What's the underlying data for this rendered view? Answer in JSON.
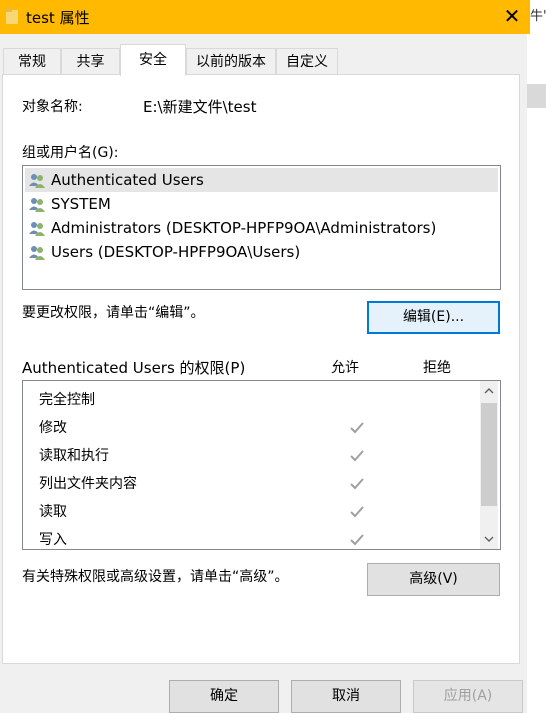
{
  "window": {
    "title": "test 属性",
    "close_glyph": "✕",
    "right_edge_text": "牛'"
  },
  "tabs": [
    {
      "label": "常规",
      "active": false
    },
    {
      "label": "共享",
      "active": false
    },
    {
      "label": "安全",
      "active": true
    },
    {
      "label": "以前的版本",
      "active": false
    },
    {
      "label": "自定义",
      "active": false
    }
  ],
  "object": {
    "label": "对象名称:",
    "value": "E:\\新建文件\\test"
  },
  "groups": {
    "label": "组或用户名(G):",
    "items": [
      {
        "name": "Authenticated Users",
        "selected": true,
        "icon": "user-group-icon"
      },
      {
        "name": "SYSTEM",
        "selected": false,
        "icon": "user-group-icon"
      },
      {
        "name": "Administrators (DESKTOP-HPFP9OA\\Administrators)",
        "selected": false,
        "icon": "user-group-icon"
      },
      {
        "name": "Users (DESKTOP-HPFP9OA\\Users)",
        "selected": false,
        "icon": "user-group-icon"
      }
    ]
  },
  "edit": {
    "hint": "要更改权限，请单击“编辑”。",
    "button": "编辑(E)..."
  },
  "permissions": {
    "title": "Authenticated Users 的权限(P)",
    "allow_header": "允许",
    "deny_header": "拒绝",
    "rows": [
      {
        "name": "完全控制",
        "allow": false,
        "deny": false
      },
      {
        "name": "修改",
        "allow": true,
        "deny": false
      },
      {
        "name": "读取和执行",
        "allow": true,
        "deny": false
      },
      {
        "name": "列出文件夹内容",
        "allow": true,
        "deny": false
      },
      {
        "name": "读取",
        "allow": true,
        "deny": false
      },
      {
        "name": "写入",
        "allow": true,
        "deny": false
      }
    ]
  },
  "advanced": {
    "hint": "有关特殊权限或高级设置，请单击“高级”。",
    "button": "高级(V)"
  },
  "footer": {
    "ok": "确定",
    "cancel": "取消",
    "apply": "应用(A)"
  },
  "colors": {
    "titlebar": "#ffb900",
    "focus": "#0078d7",
    "check": "#a0a0a0"
  }
}
